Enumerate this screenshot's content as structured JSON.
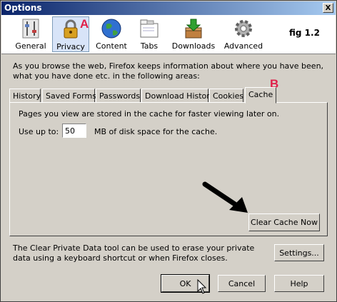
{
  "window": {
    "title": "Options",
    "close_label": "X"
  },
  "toolbar": {
    "items": [
      {
        "label": "General",
        "icon": "sliders-icon"
      },
      {
        "label": "Privacy",
        "icon": "lock-icon"
      },
      {
        "label": "Content",
        "icon": "globe-icon"
      },
      {
        "label": "Tabs",
        "icon": "tabs-icon"
      },
      {
        "label": "Downloads",
        "icon": "download-box-icon"
      },
      {
        "label": "Advanced",
        "icon": "gear-icon"
      }
    ],
    "selected": "Privacy",
    "fig_label": "fig 1.2"
  },
  "annotations": {
    "a": "A",
    "b": "B",
    "accent_color": "#e0204a"
  },
  "description": "As you browse the web, Firefox keeps information about where you have been, what you have done etc. in the following areas:",
  "tabs": [
    {
      "label": "History"
    },
    {
      "label": "Saved Forms"
    },
    {
      "label": "Passwords"
    },
    {
      "label": "Download History"
    },
    {
      "label": "Cookies"
    },
    {
      "label": "Cache"
    }
  ],
  "active_tab": "Cache",
  "cache": {
    "info": "Pages you view are stored in the cache for faster viewing later on.",
    "use_up_label": "Use up to:",
    "value": "50",
    "unit_text": "MB of disk space for the cache.",
    "clear_button": "Clear Cache Now"
  },
  "private_data": {
    "text": "The Clear Private Data tool can be used to erase your private data using a keyboard shortcut or when Firefox closes.",
    "settings_button": "Settings..."
  },
  "footer": {
    "ok": "OK",
    "cancel": "Cancel",
    "help": "Help"
  }
}
